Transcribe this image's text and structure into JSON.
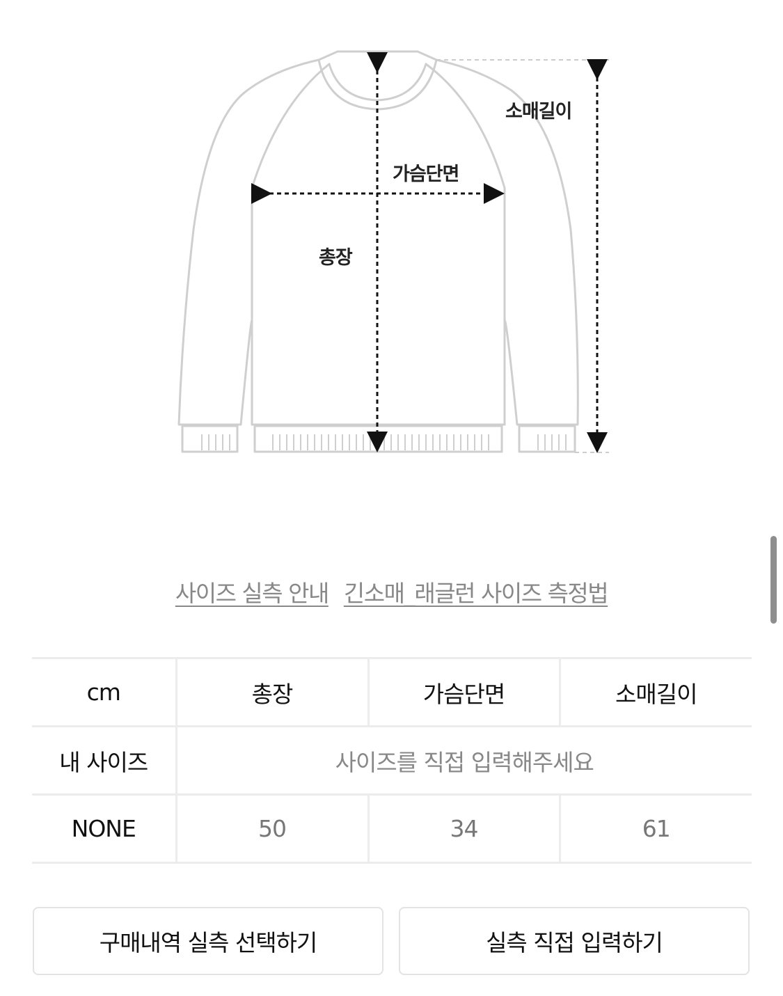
{
  "diagram": {
    "labels": {
      "sleeve_length": "소매길이",
      "chest_width": "가슴단면",
      "total_length": "총장"
    }
  },
  "links": {
    "size_guide": "사이즈 실측 안내",
    "measure_method": "긴소매_래글런 사이즈 측정법"
  },
  "table": {
    "unit": "cm",
    "columns": [
      "총장",
      "가슴단면",
      "소매길이"
    ],
    "my_size": {
      "label": "내 사이즈",
      "placeholder": "사이즈를 직접 입력해주세요"
    },
    "rows": [
      {
        "size": "NONE",
        "values": [
          "50",
          "34",
          "61"
        ]
      }
    ]
  },
  "buttons": {
    "select_from_history": "구매내역 실측 선택하기",
    "enter_directly": "실측 직접 입력하기"
  },
  "colors": {
    "outline": "#cfcfcf",
    "border": "#ececec",
    "muted_text": "#888888"
  }
}
